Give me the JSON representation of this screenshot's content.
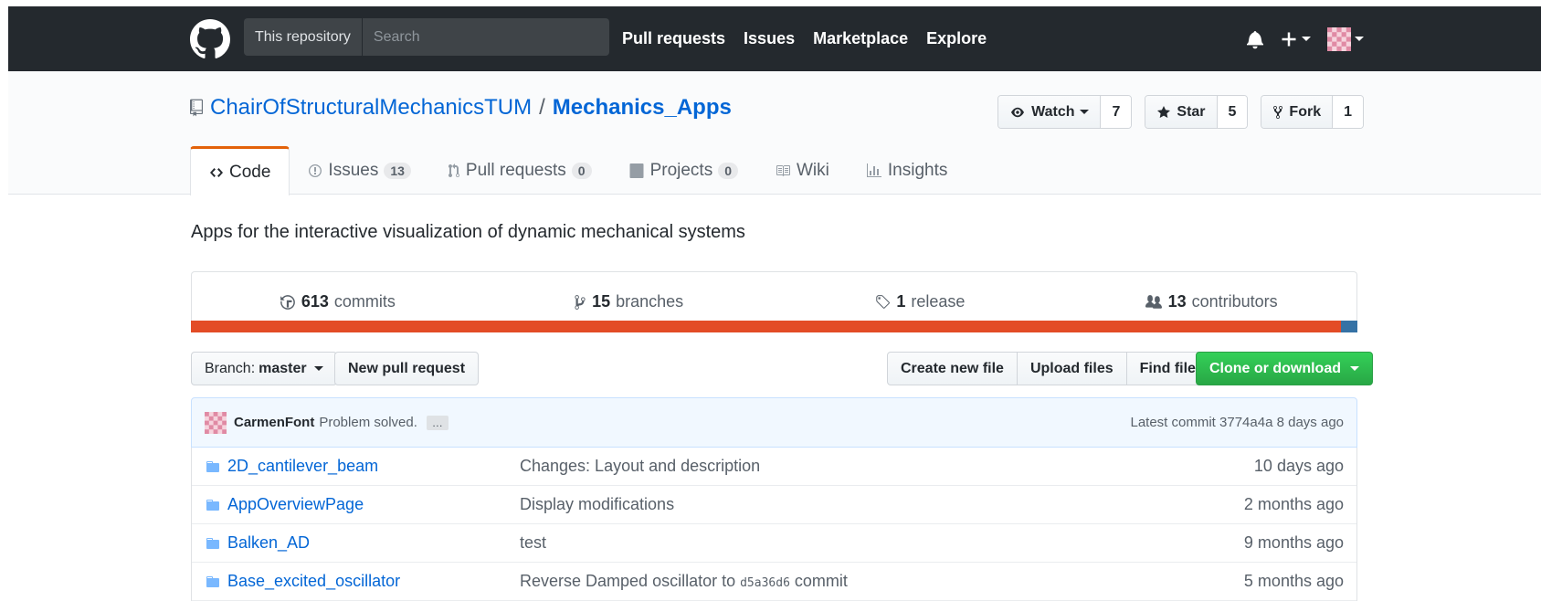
{
  "topnav": {
    "scope": "This repository",
    "search_placeholder": "Search",
    "links": [
      "Pull requests",
      "Issues",
      "Marketplace",
      "Explore"
    ]
  },
  "repo": {
    "owner": "ChairOfStructuralMechanicsTUM",
    "separator": "/",
    "name": "Mechanics_Apps",
    "actions": {
      "watch_label": "Watch",
      "watch_count": "7",
      "star_label": "Star",
      "star_count": "5",
      "fork_label": "Fork",
      "fork_count": "1"
    },
    "tabs": [
      {
        "label": "Code",
        "count": ""
      },
      {
        "label": "Issues",
        "count": "13"
      },
      {
        "label": "Pull requests",
        "count": "0"
      },
      {
        "label": "Projects",
        "count": "0"
      },
      {
        "label": "Wiki",
        "count": ""
      },
      {
        "label": "Insights",
        "count": ""
      }
    ],
    "description": "Apps for the interactive visualization of dynamic mechanical systems"
  },
  "summary": {
    "commits_count": "613",
    "commits_label": "commits",
    "branches_count": "15",
    "branches_label": "branches",
    "releases_count": "1",
    "releases_label": "release",
    "contributors_count": "13",
    "contributors_label": "contributors"
  },
  "language_bar": [
    {
      "color": "#e34c26",
      "share": 0.986
    },
    {
      "color": "#3572a5",
      "share": 0.014
    }
  ],
  "filenav": {
    "branch_prefix": "Branch:",
    "branch_name": "master",
    "new_pr": "New pull request",
    "create_file": "Create new file",
    "upload_files": "Upload files",
    "find_file": "Find file",
    "clone": "Clone or download"
  },
  "latest_commit": {
    "author": "CarmenFont",
    "message": "Problem solved.",
    "ellipsis": "…",
    "latest_label": "Latest commit",
    "sha": "3774a4a",
    "age": "8 days ago"
  },
  "files": [
    {
      "name": "2D_cantilever_beam",
      "message": "Changes: Layout and description",
      "sha": "",
      "message_suffix": "",
      "age": "10 days ago"
    },
    {
      "name": "AppOverviewPage",
      "message": "Display modifications",
      "sha": "",
      "message_suffix": "",
      "age": "2 months ago"
    },
    {
      "name": "Balken_AD",
      "message": "test",
      "sha": "",
      "message_suffix": "",
      "age": "9 months ago"
    },
    {
      "name": "Base_excited_oscillator",
      "message": "Reverse Damped oscillator to ",
      "sha": "d5a36d6",
      "message_suffix": " commit",
      "age": "5 months ago"
    }
  ],
  "colors": {
    "header_bg": "#24292e",
    "link": "#0366d6",
    "selected_tab_accent": "#e36209",
    "clone_button": "#28a745"
  }
}
